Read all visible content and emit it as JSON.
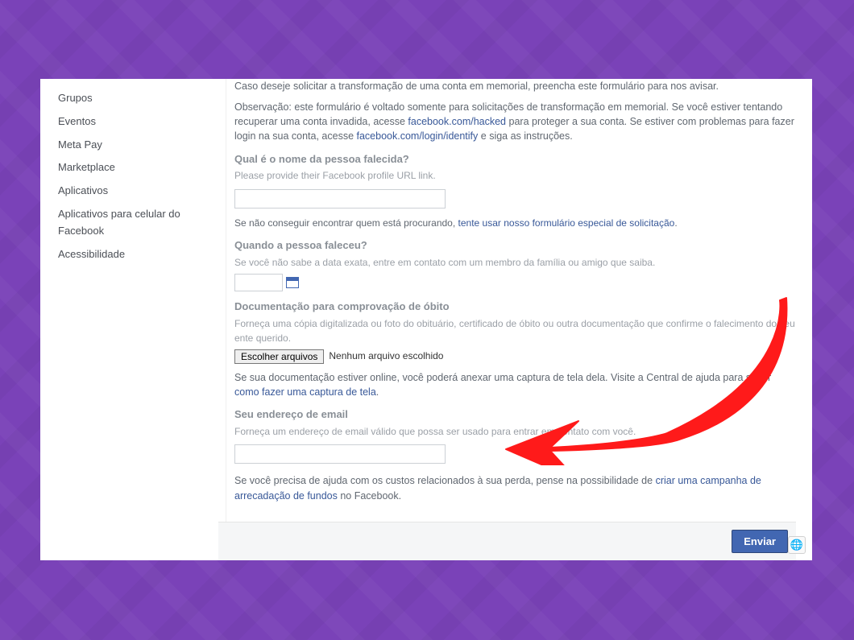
{
  "sidebar": {
    "items": [
      {
        "label": "Grupos"
      },
      {
        "label": "Eventos"
      },
      {
        "label": "Meta Pay"
      },
      {
        "label": "Marketplace"
      },
      {
        "label": "Aplicativos"
      },
      {
        "label": "Aplicativos para celular do Facebook"
      },
      {
        "label": "Acessibilidade"
      }
    ]
  },
  "form": {
    "intro": "Caso deseje solicitar a transformação de uma conta em memorial, preencha este formulário para nos avisar.",
    "observ_prefix": "Observação: este formulário é voltado somente para solicitações de transformação em memorial. Se você estiver tentando recuperar uma conta invadida, acesse ",
    "observ_link1": "facebook.com/hacked",
    "observ_mid": " para proteger a sua conta. Se estiver com problemas para fazer login na sua conta, acesse ",
    "observ_link2": "facebook.com/login/identify",
    "observ_suffix": " e siga as instruções.",
    "q_name_title": "Qual é o nome da pessoa falecida?",
    "q_name_sub": "Please provide their Facebook profile URL link.",
    "not_found_prefix": "Se não conseguir encontrar quem está procurando, ",
    "not_found_link": "tente usar nosso formulário especial de solicitação",
    "not_found_suffix": ".",
    "q_when_title": "Quando a pessoa faleceu?",
    "q_when_sub": "Se você não sabe a data exata, entre em contato com um membro da família ou amigo que saiba.",
    "q_doc_title": "Documentação para comprovação de óbito",
    "q_doc_sub": "Forneça uma cópia digitalizada ou foto do obituário, certificado de óbito ou outra documentação que confirme o falecimento do seu ente querido.",
    "file_button": "Escolher arquivos",
    "file_status": "Nenhum arquivo escolhido",
    "doc_online_prefix": "Se sua documentação estiver online, você poderá anexar uma captura de tela dela. Visite a Central de ajuda para saber ",
    "doc_online_link": "como fazer uma captura de tela",
    "doc_online_suffix": ".",
    "q_email_title": "Seu endereço de email",
    "q_email_sub": "Forneça um endereço de email válido que possa ser usado para entrar em contato com você.",
    "fund_prefix": "Se você precisa de ajuda com os custos relacionados à sua perda, pense na possibilidade de ",
    "fund_link": "criar uma campanha de arrecadação de fundos",
    "fund_suffix": " no Facebook."
  },
  "actions": {
    "send": "Enviar"
  },
  "colors": {
    "background": "#7a42b8",
    "primary_button": "#4267b2",
    "link": "#385898",
    "annotation_arrow": "#ff1a1a"
  },
  "icons": {
    "calendar": "calendar-icon",
    "globe": "globe-icon",
    "annotation_arrow": "arrow-icon"
  }
}
